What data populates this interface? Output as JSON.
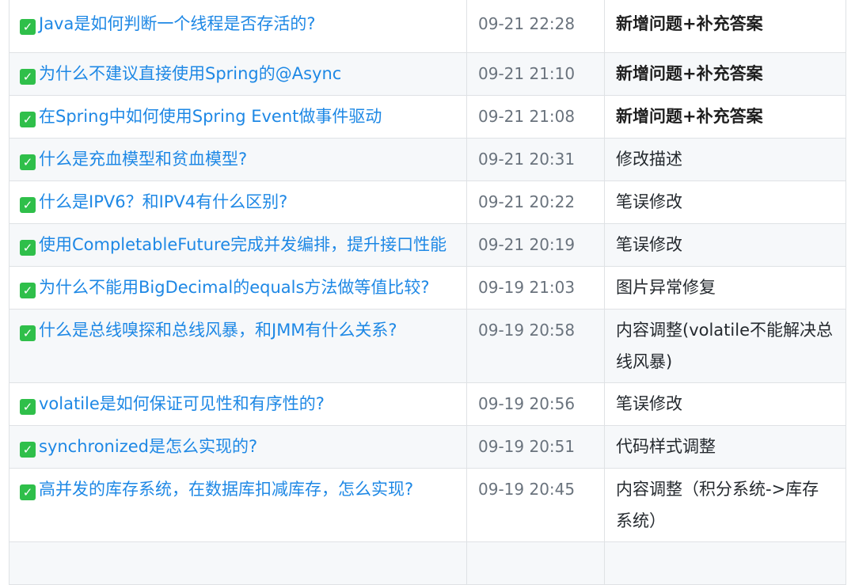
{
  "icon_names": {
    "check": "checkbox-checked-icon"
  },
  "colors": {
    "link": "#1e88e5",
    "check": "#2fbf4a",
    "time": "#6a737d",
    "border": "#dfe2e5"
  },
  "rows": [
    {
      "title": "Java是如何判断一个线程是否存活的?",
      "time": "09-21 22:28",
      "desc": "新增问题+补充答案",
      "bold": true
    },
    {
      "title": "为什么不建议直接使用Spring的@Async",
      "time": "09-21 21:10",
      "desc": "新增问题+补充答案",
      "bold": true
    },
    {
      "title": "在Spring中如何使用Spring Event做事件驱动",
      "time": "09-21 21:08",
      "desc": "新增问题+补充答案",
      "bold": true
    },
    {
      "title": "什么是充血模型和贫血模型?",
      "time": "09-21 20:31",
      "desc": "修改描述",
      "bold": false
    },
    {
      "title": "什么是IPV6？和IPV4有什么区别?",
      "time": "09-21 20:22",
      "desc": "笔误修改",
      "bold": false
    },
    {
      "title": "使用CompletableFuture完成并发编排，提升接口性能",
      "time": "09-21 20:19",
      "desc": "笔误修改",
      "bold": false
    },
    {
      "title": "为什么不能用BigDecimal的equals方法做等值比较?",
      "time": "09-19 21:03",
      "desc": "图片异常修复",
      "bold": false
    },
    {
      "title": "什么是总线嗅探和总线风暴，和JMM有什么关系?",
      "time": "09-19 20:58",
      "desc": "内容调整(volatile不能解决总线风暴)",
      "bold": false
    },
    {
      "title": "volatile是如何保证可见性和有序性的?",
      "time": "09-19 20:56",
      "desc": "笔误修改",
      "bold": false
    },
    {
      "title": "synchronized是怎么实现的?",
      "time": "09-19 20:51",
      "desc": "代码样式调整",
      "bold": false
    },
    {
      "title": "高并发的库存系统，在数据库扣减库存，怎么实现?",
      "time": "09-19 20:45",
      "desc": "内容调整（积分系统->库存系统）",
      "bold": false
    }
  ]
}
